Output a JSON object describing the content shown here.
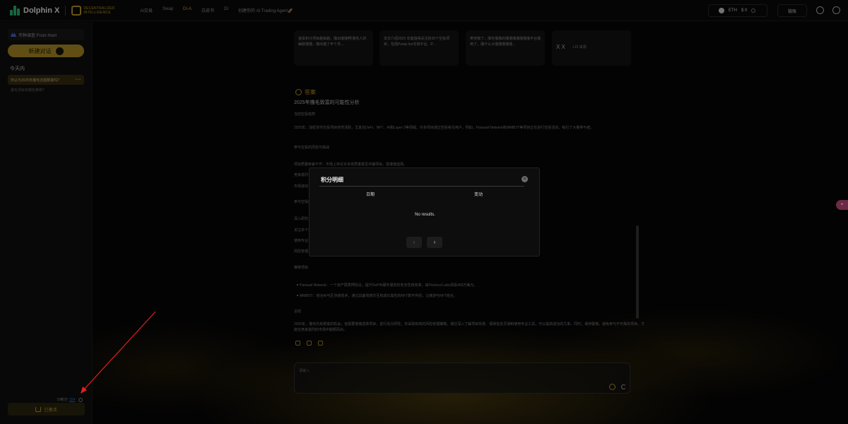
{
  "header": {
    "app_name": "Dolphin X",
    "partner_name": "DECENTRALIZED INTELLIGENCE",
    "nav": [
      "AI交易",
      "Swap",
      "DI-A",
      "白皮书",
      "DI",
      "创建你的 AI Trading Agent🚀"
    ],
    "active_nav_index": 2,
    "wallet": {
      "token": "ETH",
      "balance": "$ 0"
    },
    "connect_label": "链账"
  },
  "sidebar": {
    "from_hunt": "币种调查 From Hunt",
    "new_chat": "新建对话",
    "section_today": "今天内",
    "history": [
      {
        "label": "你认为2025年撸毛还能致富吗?",
        "active": true
      },
      {
        "label": "撸毛项目有哪些推荐?",
        "active": false
      }
    ],
    "points_label": "DI积分",
    "points_value": "324",
    "activated_label": "已激活"
  },
  "main": {
    "cards": [
      {
        "text": "首投积分项目越来越，撸出撸撸啊!撸毛人的幽默撸撸，撸出撸了丰个月..."
      },
      {
        "text": "本文介绍2025 年最值得关注的20个空投项目，包括Pump.fun交易平台、P..."
      },
      {
        "text": "笑死我了，撸毛撸撸的撸撸撸撸撸撸撸平台撸用了，撸什么大撸撸撸撸撸..."
      },
      {
        "text": "X   X",
        "more": "+15 来源"
      }
    ],
    "answer_label": "答案",
    "answer_title": "2025年撸毛致富的可能性分析",
    "paragraphs": [
      "当前空投趋势",
      "2025年，加密货币空投项目依然活跃，尤其在DeFi、NFT、AI和Layer 2等领域。许多项目通过空投吸引用户，例如，Parasail Network和MMBOT等项目正在进行空投活动，吸引了大量参与者。",
      "参与空投的风险与挑战",
      "项目质量参差不齐：市场上存在许多低质量甚至诈骗项目，需谨慎选择。",
      "竞争激烈：随着参与人数增加，空投收益可能被稀释。",
      "市场波动：加密市场波动大，空投代币价值不稳定。",
      "参与空投的策略",
      "深入研究：了解项目背景、团队和技术，选择有潜力的项目。",
      "关注多个项目：分散参与，提高获得空投的机会。",
      "使用专业工具：利用空投追踪工具，提高效率。",
      "风险管理：不要投入过多资金，保护个人信息。",
      "推荐项目",
      "Parasail Network：一个资产再质押协议，提升DePIN硬件服务的安全性和效率，由Protocol Labs领投400万美元。",
      "MMBOT：结合AI与区块链技术，通过具备情感交互和成长属性的NFT数字伴侣，让链游与NFT结合。",
      "总结",
      "2025年，撸毛仍有致富的机会，但需要谨慎选择项目，进行充分研究，并采取有效的风险管理策略。通过深入了解项目背景、保持信息灵通和使用专业工具，可以提高成功的几率。同时，保持警惕，避免参与不可靠的项目，才能在竞争激烈的市场中脱颖而出。"
    ],
    "input_placeholder": "请输入"
  },
  "modal": {
    "title": "积分明细",
    "columns": [
      "日期",
      "变动"
    ],
    "empty_text": "No results.",
    "prev": "‹",
    "next": "›",
    "close": "×"
  },
  "side_badge": "+"
}
